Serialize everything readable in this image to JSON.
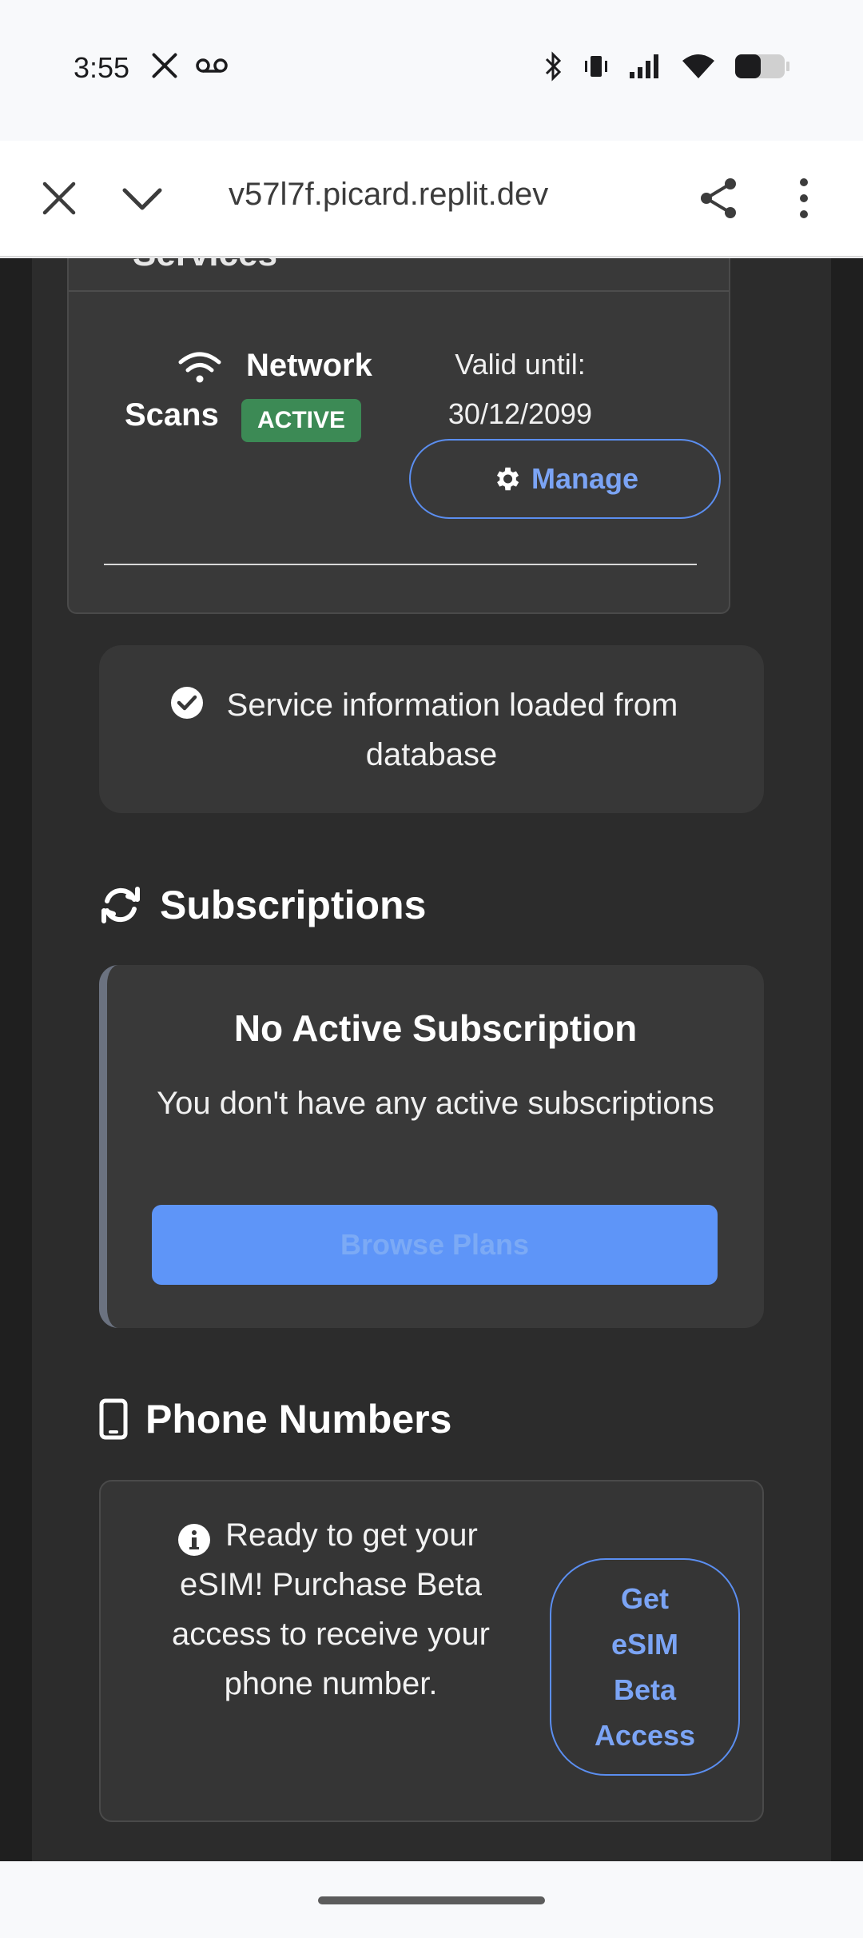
{
  "status_bar": {
    "time": "3:55",
    "left_icons": [
      "x-app-icon",
      "voicemail-icon"
    ],
    "right_icons": [
      "bluetooth-icon",
      "vibrate-icon",
      "signal-icon",
      "wifi-icon",
      "battery-icon"
    ]
  },
  "browser": {
    "url": "v57l7f.picard.replit.dev"
  },
  "services": {
    "card_title": "Services",
    "item": {
      "name_line1": "Network",
      "name_line2": "Scans",
      "status": "ACTIVE",
      "valid_label": "Valid until:",
      "valid_date": "30/12/2099",
      "manage_label": "Manage"
    },
    "info_message": "Service information loaded from database"
  },
  "subscriptions": {
    "heading": "Subscriptions",
    "empty_title": "No Active Subscription",
    "empty_text": "You don't have any active subscriptions",
    "browse_label": "Browse Plans"
  },
  "phone_numbers": {
    "heading": "Phone Numbers",
    "message": "Ready to get your eSIM! Purchase Beta access to receive your phone number.",
    "cta_label": "Get eSIM Beta Access"
  },
  "colors": {
    "accent": "#5b8ef0",
    "active_badge": "#3c8a55",
    "page_bg": "#2c2c2c",
    "card_bg": "#393939"
  }
}
